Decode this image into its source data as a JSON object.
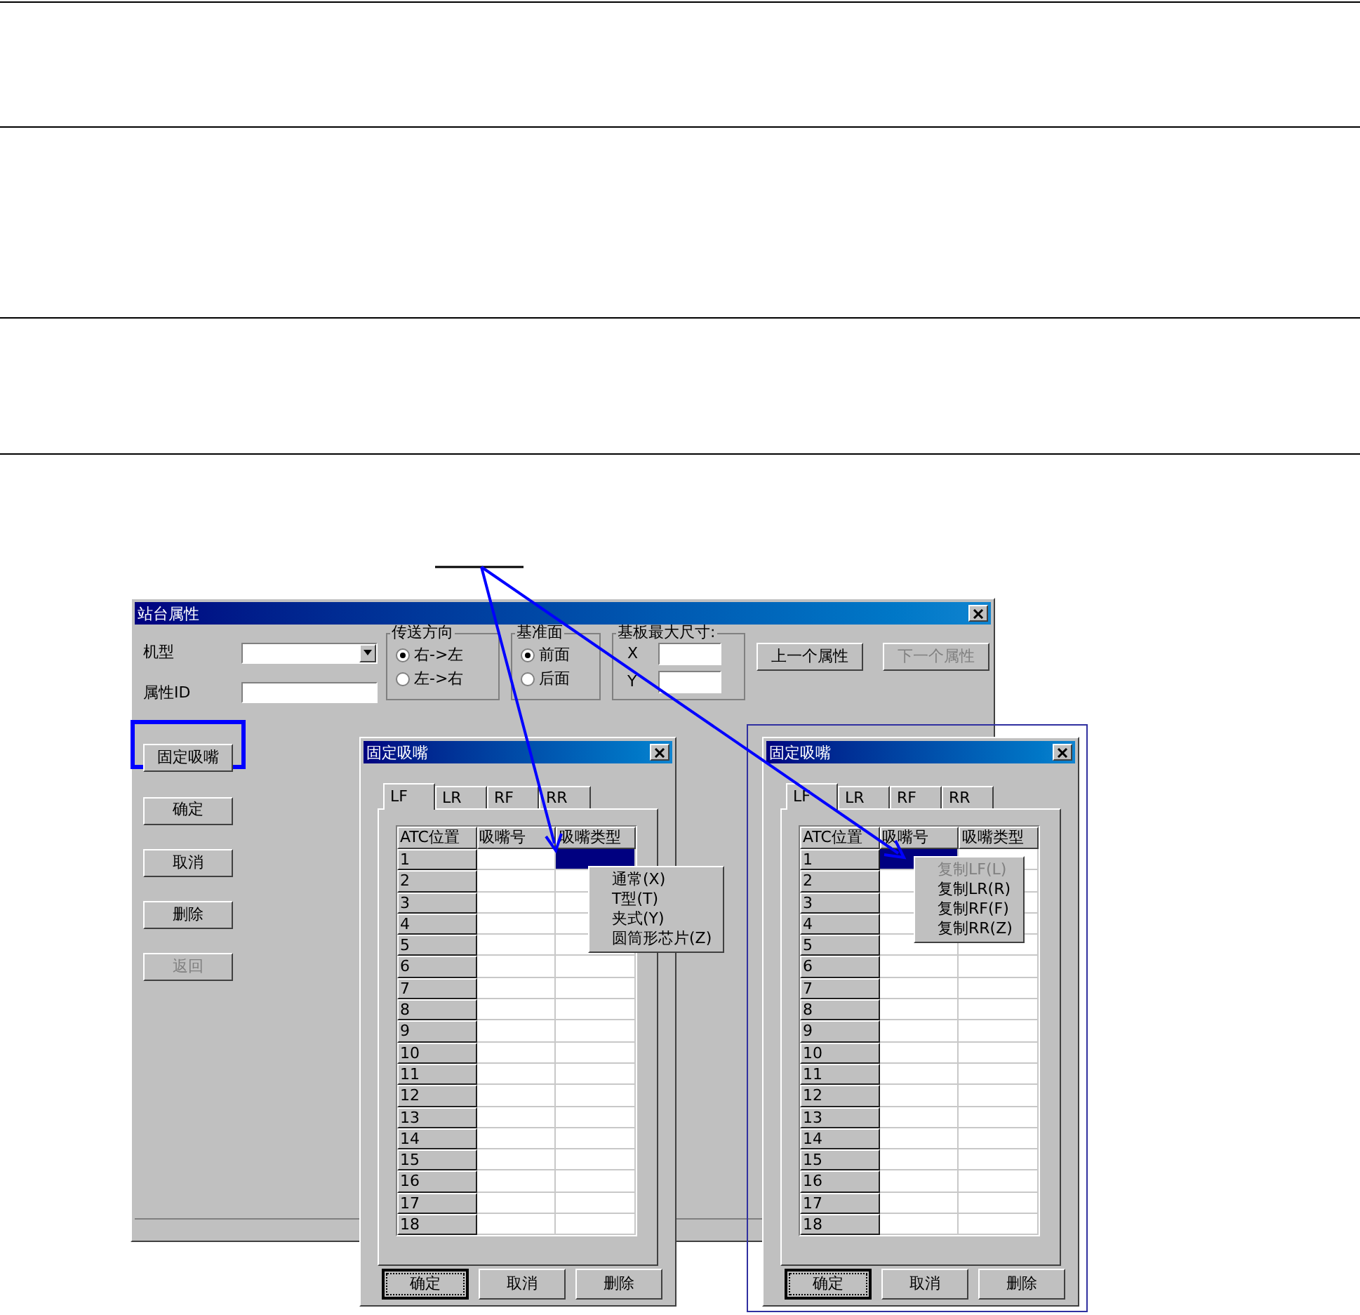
{
  "main_window": {
    "title": "站台属性",
    "fields": [
      {
        "label": "机型",
        "kind": "dropdown"
      },
      {
        "label": "属性ID",
        "kind": "text"
      }
    ],
    "radio_groups": [
      {
        "title": "传送方向",
        "options": [
          {
            "label": "右->左",
            "selected": true
          },
          {
            "label": "左->右",
            "selected": false
          }
        ]
      },
      {
        "title": "基准面",
        "options": [
          {
            "label": "前面",
            "selected": true
          },
          {
            "label": "后面",
            "selected": false
          }
        ]
      }
    ],
    "size_group": {
      "title": "基板最大尺寸:",
      "fields": [
        {
          "label": "X"
        },
        {
          "label": "Y"
        }
      ]
    },
    "nav_buttons": [
      {
        "label": "上一个属性",
        "disabled": false
      },
      {
        "label": "下一个属性",
        "disabled": true
      }
    ],
    "side_buttons": [
      {
        "label": "固定吸嘴",
        "disabled": false,
        "highlighted": true
      },
      {
        "label": "确定",
        "disabled": false,
        "highlighted": false
      },
      {
        "label": "取消",
        "disabled": false,
        "highlighted": false
      },
      {
        "label": "删除",
        "disabled": false,
        "highlighted": false
      },
      {
        "label": "返回",
        "disabled": true,
        "highlighted": false
      }
    ]
  },
  "dialogs": [
    {
      "title": "固定吸嘴",
      "highlighted": false,
      "tabs": [
        {
          "label": "LF",
          "selected": true
        },
        {
          "label": "LR",
          "selected": false
        },
        {
          "label": "RF",
          "selected": false
        },
        {
          "label": "RR",
          "selected": false
        }
      ],
      "columns": [
        "ATC位置",
        "吸嘴号",
        "吸嘴类型"
      ],
      "rows": [
        {
          "label": "1",
          "cells": [
            {
              "selected": false
            },
            {
              "selected": true
            }
          ]
        },
        {
          "label": "2",
          "cells": [
            {
              "selected": false
            },
            {
              "selected": false
            }
          ]
        },
        {
          "label": "3",
          "cells": [
            {
              "selected": false
            },
            {
              "selected": false
            }
          ]
        },
        {
          "label": "4",
          "cells": [
            {
              "selected": false
            },
            {
              "selected": false
            }
          ]
        },
        {
          "label": "5",
          "cells": [
            {
              "selected": false
            },
            {
              "selected": false
            }
          ]
        },
        {
          "label": "6",
          "cells": [
            {
              "selected": false
            },
            {
              "selected": false
            }
          ]
        },
        {
          "label": "7",
          "cells": [
            {
              "selected": false
            },
            {
              "selected": false
            }
          ]
        },
        {
          "label": "8",
          "cells": [
            {
              "selected": false
            },
            {
              "selected": false
            }
          ]
        },
        {
          "label": "9",
          "cells": [
            {
              "selected": false
            },
            {
              "selected": false
            }
          ]
        },
        {
          "label": "10",
          "cells": [
            {
              "selected": false
            },
            {
              "selected": false
            }
          ]
        },
        {
          "label": "11",
          "cells": [
            {
              "selected": false
            },
            {
              "selected": false
            }
          ]
        },
        {
          "label": "12",
          "cells": [
            {
              "selected": false
            },
            {
              "selected": false
            }
          ]
        },
        {
          "label": "13",
          "cells": [
            {
              "selected": false
            },
            {
              "selected": false
            }
          ]
        },
        {
          "label": "14",
          "cells": [
            {
              "selected": false
            },
            {
              "selected": false
            }
          ]
        },
        {
          "label": "15",
          "cells": [
            {
              "selected": false
            },
            {
              "selected": false
            }
          ]
        },
        {
          "label": "16",
          "cells": [
            {
              "selected": false
            },
            {
              "selected": false
            }
          ]
        },
        {
          "label": "17",
          "cells": [
            {
              "selected": false
            },
            {
              "selected": false
            }
          ]
        },
        {
          "label": "18",
          "cells": [
            {
              "selected": false
            },
            {
              "selected": false
            }
          ]
        }
      ],
      "menu": [
        {
          "label": "通常(X)",
          "disabled": false
        },
        {
          "label": "T型(T)",
          "disabled": false
        },
        {
          "label": "夹式(Y)",
          "disabled": false
        },
        {
          "label": "圆筒形芯片(Z)",
          "disabled": false
        }
      ],
      "buttons": [
        {
          "label": "确定",
          "focused": true
        },
        {
          "label": "取消",
          "focused": false
        },
        {
          "label": "删除",
          "focused": false
        }
      ]
    },
    {
      "title": "固定吸嘴",
      "highlighted": true,
      "tabs": [
        {
          "label": "LF",
          "selected": true
        },
        {
          "label": "LR",
          "selected": false
        },
        {
          "label": "RF",
          "selected": false
        },
        {
          "label": "RR",
          "selected": false
        }
      ],
      "columns": [
        "ATC位置",
        "吸嘴号",
        "吸嘴类型"
      ],
      "rows": [
        {
          "label": "1",
          "cells": [
            {
              "selected": true
            },
            {
              "selected": false
            }
          ]
        },
        {
          "label": "2",
          "cells": [
            {
              "selected": false
            },
            {
              "selected": false
            }
          ]
        },
        {
          "label": "3",
          "cells": [
            {
              "selected": false
            },
            {
              "selected": false
            }
          ]
        },
        {
          "label": "4",
          "cells": [
            {
              "selected": false
            },
            {
              "selected": false
            }
          ]
        },
        {
          "label": "5",
          "cells": [
            {
              "selected": false
            },
            {
              "selected": false
            }
          ]
        },
        {
          "label": "6",
          "cells": [
            {
              "selected": false
            },
            {
              "selected": false
            }
          ]
        },
        {
          "label": "7",
          "cells": [
            {
              "selected": false
            },
            {
              "selected": false
            }
          ]
        },
        {
          "label": "8",
          "cells": [
            {
              "selected": false
            },
            {
              "selected": false
            }
          ]
        },
        {
          "label": "9",
          "cells": [
            {
              "selected": false
            },
            {
              "selected": false
            }
          ]
        },
        {
          "label": "10",
          "cells": [
            {
              "selected": false
            },
            {
              "selected": false
            }
          ]
        },
        {
          "label": "11",
          "cells": [
            {
              "selected": false
            },
            {
              "selected": false
            }
          ]
        },
        {
          "label": "12",
          "cells": [
            {
              "selected": false
            },
            {
              "selected": false
            }
          ]
        },
        {
          "label": "13",
          "cells": [
            {
              "selected": false
            },
            {
              "selected": false
            }
          ]
        },
        {
          "label": "14",
          "cells": [
            {
              "selected": false
            },
            {
              "selected": false
            }
          ]
        },
        {
          "label": "15",
          "cells": [
            {
              "selected": false
            },
            {
              "selected": false
            }
          ]
        },
        {
          "label": "16",
          "cells": [
            {
              "selected": false
            },
            {
              "selected": false
            }
          ]
        },
        {
          "label": "17",
          "cells": [
            {
              "selected": false
            },
            {
              "selected": false
            }
          ]
        },
        {
          "label": "18",
          "cells": [
            {
              "selected": false
            },
            {
              "selected": false
            }
          ]
        }
      ],
      "menu": [
        {
          "label": "复制LF(L)",
          "disabled": true
        },
        {
          "label": "复制LR(R)",
          "disabled": false
        },
        {
          "label": "复制RF(F)",
          "disabled": false
        },
        {
          "label": "复制RR(Z)",
          "disabled": false
        }
      ],
      "buttons": [
        {
          "label": "确定",
          "focused": true
        },
        {
          "label": "取消",
          "focused": false
        },
        {
          "label": "删除",
          "focused": false
        }
      ]
    }
  ]
}
